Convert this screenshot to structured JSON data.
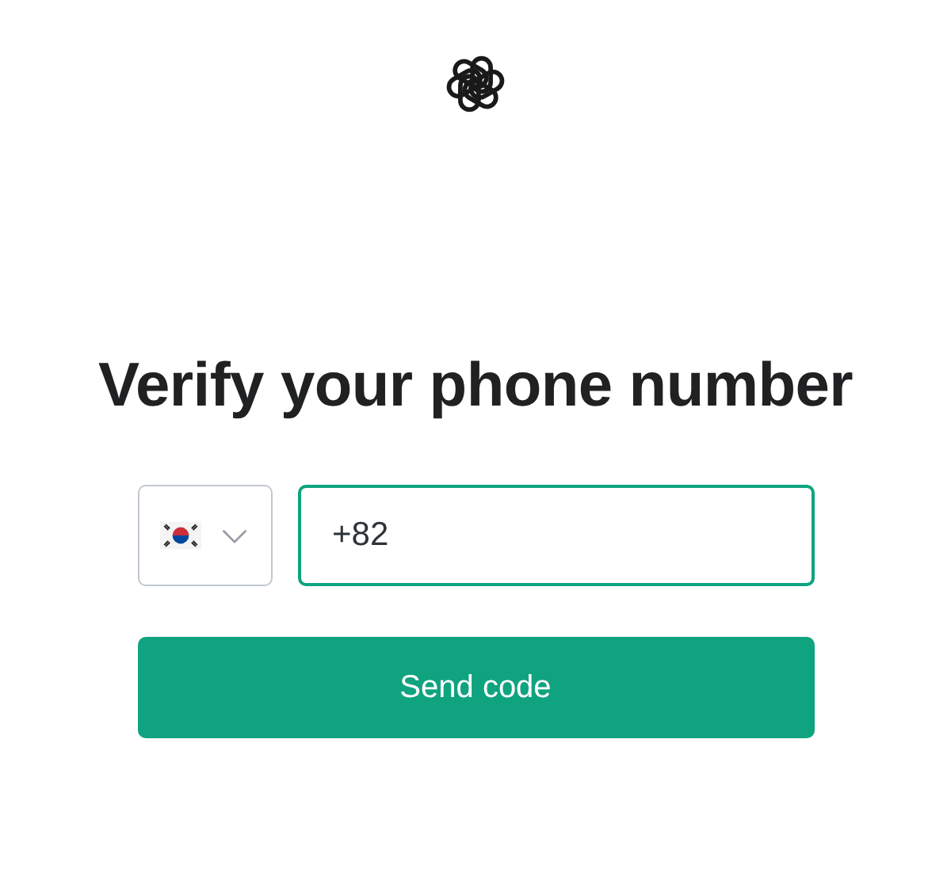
{
  "heading": "Verify your phone number",
  "country_select": {
    "kind": "flag-kr"
  },
  "phone_field": {
    "value": "+82",
    "focused": true
  },
  "submit_button": {
    "label": "Send code"
  }
}
